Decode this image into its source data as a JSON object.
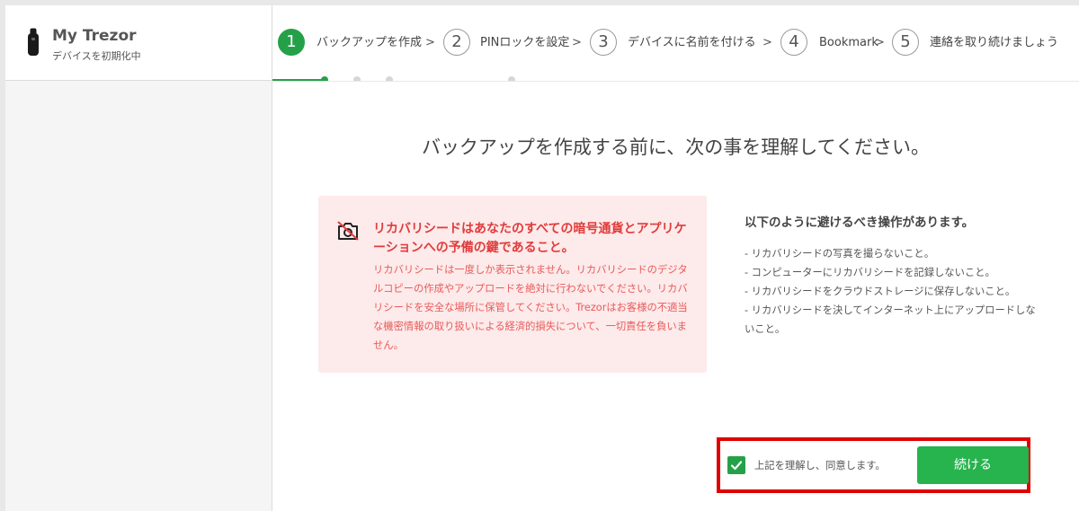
{
  "sidebar": {
    "device_name": "My Trezor",
    "device_status": "デバイスを初期化中"
  },
  "stepper": {
    "steps": [
      {
        "number": "1",
        "label": "バックアップを作成",
        "active": true
      },
      {
        "number": "2",
        "label": "PINロックを設定",
        "active": false
      },
      {
        "number": "3",
        "label": "デバイスに名前を付ける",
        "active": false
      },
      {
        "number": "4",
        "label": "Bookmark",
        "active": false
      },
      {
        "number": "5",
        "label": "連絡を取り続けましょう",
        "active": false
      }
    ]
  },
  "main": {
    "heading": "バックアップを作成する前に、次の事を理解してください。",
    "warning": {
      "title": "リカバリシードはあなたのすべての暗号通貨とアプリケーションへの予備の鍵であること。",
      "body": "リカバリシードは一度しか表示されません。リカバリシードのデジタルコピーの作成やアップロードを絶対に行わないでください。リカバリシードを安全な場所に保管してください。Trezorはお客様の不適当な機密情報の取り扱いによる経済的損失について、一切責任を負いません。",
      "icon": "no-camera-icon"
    },
    "avoid": {
      "title": "以下のように避けるべき操作があります。",
      "items": [
        "- リカバリシードの写真を撮らないこと。",
        "- コンピューターにリカバリシードを記録しないこと。",
        "- リカバリシードをクラウドストレージに保存しないこと。",
        "- リカバリシードを決してインターネット上にアップロードしないこと。"
      ]
    },
    "footer": {
      "agree_label": "上記を理解し、同意します。",
      "agree_checked": true,
      "continue_label": "続ける"
    }
  },
  "colors": {
    "accent": "#24a148",
    "warning_bg": "#fdeaea",
    "warning_text": "#e03c3c",
    "highlight_border": "#e00000"
  }
}
